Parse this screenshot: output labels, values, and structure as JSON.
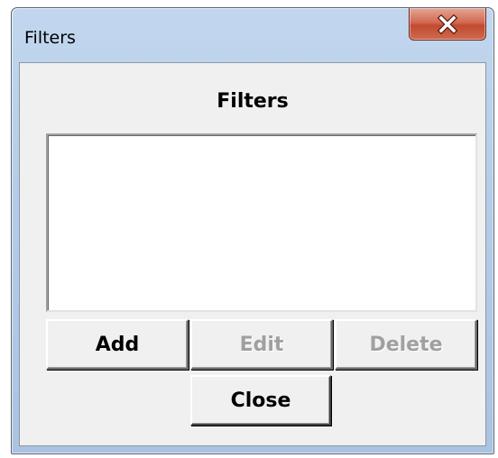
{
  "window": {
    "title": "Filters"
  },
  "dialog": {
    "heading": "Filters",
    "filters_list": []
  },
  "buttons": {
    "add_label": "Add",
    "edit_label": "Edit",
    "delete_label": "Delete",
    "close_label": "Close"
  },
  "icons": {
    "close": "close-icon"
  },
  "colors": {
    "close_button": "#c94f36",
    "frame": "#b5cde8",
    "client": "#f0f0f0",
    "disabled_text": "#a0a0a0"
  }
}
